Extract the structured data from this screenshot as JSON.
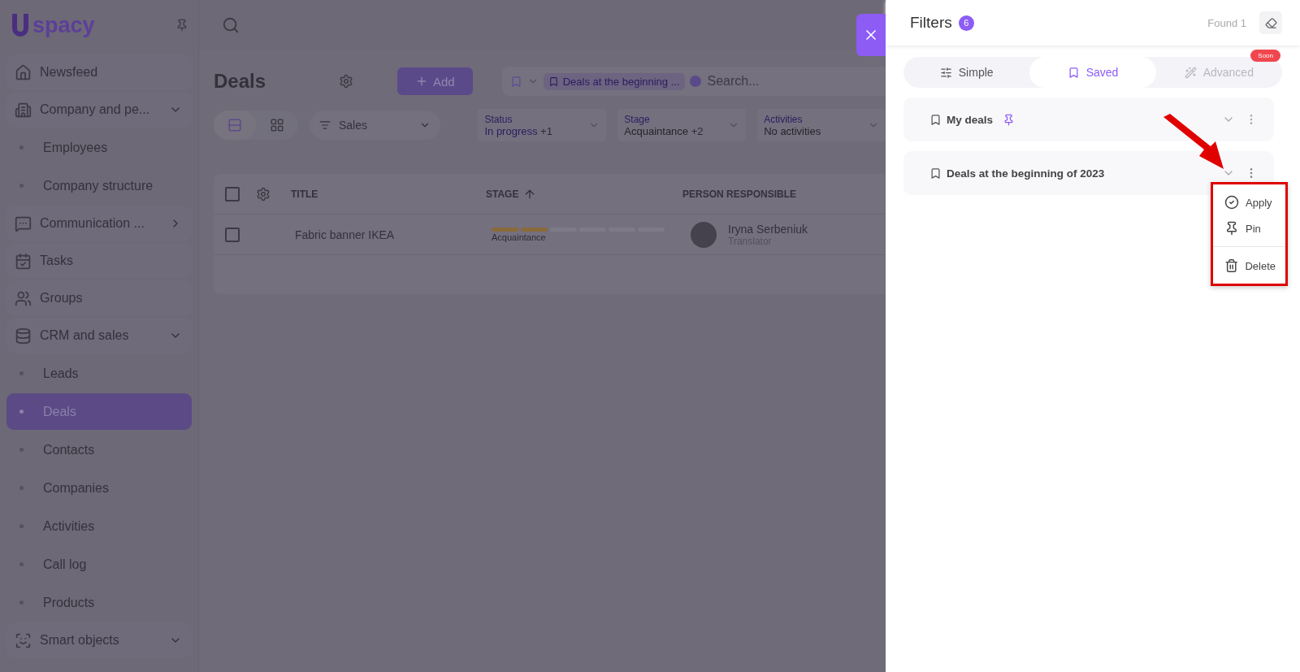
{
  "sidebar": {
    "logo_text": "spacy",
    "items": [
      {
        "label": "Newsfeed",
        "selected": false
      },
      {
        "label": "Company and pe...",
        "selected": false,
        "expanded": true,
        "children": [
          {
            "label": "Employees",
            "selected": false
          },
          {
            "label": "Company structure",
            "selected": false
          }
        ]
      },
      {
        "label": "Communication ...",
        "selected": false,
        "expanded": false
      },
      {
        "label": "Tasks",
        "selected": false
      },
      {
        "label": "Groups",
        "selected": false
      },
      {
        "label": "CRM and sales",
        "selected": false,
        "expanded": true,
        "children": [
          {
            "label": "Leads",
            "selected": false
          },
          {
            "label": "Deals",
            "selected": true
          },
          {
            "label": "Contacts",
            "selected": false
          },
          {
            "label": "Companies",
            "selected": false
          },
          {
            "label": "Activities",
            "selected": false
          },
          {
            "label": "Call log",
            "selected": false
          },
          {
            "label": "Products",
            "selected": false
          }
        ]
      },
      {
        "label": "Smart objects",
        "selected": false,
        "expanded": true
      }
    ]
  },
  "main": {
    "title": "Deals",
    "add_button": "Add",
    "search": {
      "chip": "Deals at the beginning ...",
      "placeholder": "Search..."
    },
    "views": [
      {
        "selected": true
      },
      {
        "selected": false
      }
    ],
    "pipeline": "Sales",
    "filters": [
      {
        "label": "Status",
        "value": "In progress",
        "extra": "+1"
      },
      {
        "label": "Stage",
        "value": "Acquaintance",
        "extra": "+2"
      },
      {
        "label": "Activities",
        "value": "No activities"
      }
    ],
    "table": {
      "all_checked": false,
      "columns": [
        "TITLE",
        "STAGE",
        "PERSON RESPONSIBLE"
      ],
      "rows": [
        {
          "checked": false,
          "title": "Fabric banner IKEA",
          "stage": "Acquaintance",
          "level": 0.333,
          "person": "Iryna Serbeniuk",
          "role": "Translator"
        }
      ]
    }
  },
  "drawer": {
    "title": "Filters",
    "count": "6",
    "found": "Found 1",
    "tabs": [
      {
        "label": "Simple",
        "selected": false,
        "disabled": false
      },
      {
        "label": "Saved",
        "selected": true,
        "disabled": false
      },
      {
        "label": "Advanced",
        "selected": false,
        "disabled": true,
        "badge": "Soon"
      }
    ],
    "saved": [
      {
        "name": "My deals",
        "pinned": true,
        "menu_open": false
      },
      {
        "name": "Deals at the beginning of 2023",
        "pinned": false,
        "menu_open": true
      }
    ],
    "menu": [
      {
        "label": "Apply",
        "divider_before": false
      },
      {
        "label": "Pin",
        "divider_before": false
      },
      {
        "label": "Delete",
        "divider_before": true
      }
    ]
  }
}
